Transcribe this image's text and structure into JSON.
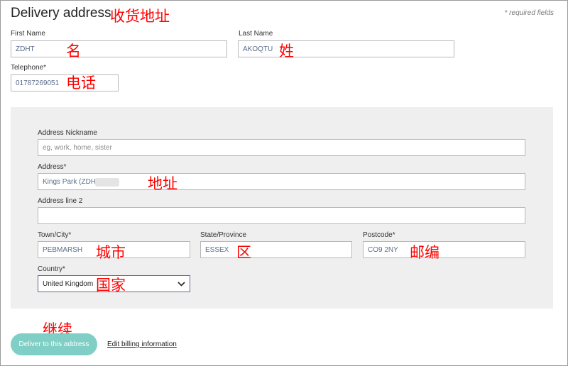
{
  "header": {
    "title": "Delivery address",
    "title_annotation": "收货地址",
    "required_note": "* required fields"
  },
  "first_name": {
    "label": "First Name",
    "value": "ZDHT",
    "annotation": "名"
  },
  "last_name": {
    "label": "Last Name",
    "value": "AKOQTU",
    "annotation": "姓"
  },
  "telephone": {
    "label": "Telephone*",
    "value": "01787269051",
    "annotation": "电话"
  },
  "address_nickname": {
    "label": "Address Nickname",
    "placeholder": "eg, work, home, sister"
  },
  "address": {
    "label": "Address*",
    "value": "Kings Park (ZDHT",
    "annotation": "地址"
  },
  "address_line2": {
    "label": "Address line 2",
    "value": ""
  },
  "town": {
    "label": "Town/City*",
    "value": "PEBMARSH",
    "annotation": "城市"
  },
  "state": {
    "label": "State/Province",
    "value": "ESSEX",
    "annotation": "区"
  },
  "postcode": {
    "label": "Postcode*",
    "value": "CO9 2NY",
    "annotation": "邮编"
  },
  "country": {
    "label": "Country*",
    "value": "United Kingdom",
    "annotation": "国家",
    "icon": "chevron-down-icon"
  },
  "footer": {
    "continue_annotation": "继续",
    "deliver_button": "Deliver to this address",
    "billing_link": "Edit billing information"
  },
  "colors": {
    "button": "#7fcfc6",
    "annotation": "#ff0000",
    "panel": "#efefef"
  }
}
